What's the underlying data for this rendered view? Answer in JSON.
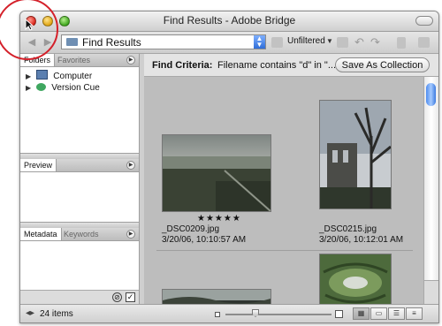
{
  "window": {
    "title": "Find Results - Adobe Bridge"
  },
  "toolbar": {
    "back_icon": "back-arrow-icon",
    "forward_icon": "forward-arrow-icon",
    "location": "Find Results",
    "filter": "Unfiltered",
    "rotate_left_glyph": "↶",
    "rotate_right_glyph": "↷"
  },
  "left_panel": {
    "top_tabs": [
      "Folders",
      "Favorites"
    ],
    "tree": [
      {
        "label": "Computer",
        "icon": "computer-icon"
      },
      {
        "label": "Version Cue",
        "icon": "version-cue-icon"
      }
    ],
    "preview_tab": "Preview",
    "bottom_tabs": [
      "Metadata",
      "Keywords"
    ]
  },
  "content": {
    "criteria_label": "Find Criteria:",
    "criteria_text": "Filename contains \"d\" in \"...",
    "save_button": "Save As Collection",
    "items": [
      {
        "name": "_DSC0209.jpg",
        "date": "3/20/06, 10:10:57 AM",
        "rating": "★★★★★"
      },
      {
        "name": "_DSC0215.jpg",
        "date": "3/20/06, 10:12:01 AM",
        "rating": ""
      }
    ]
  },
  "status": {
    "count_text": "24 items"
  },
  "colors": {
    "annotation": "#d4202a",
    "accent": "#3d7be0"
  }
}
